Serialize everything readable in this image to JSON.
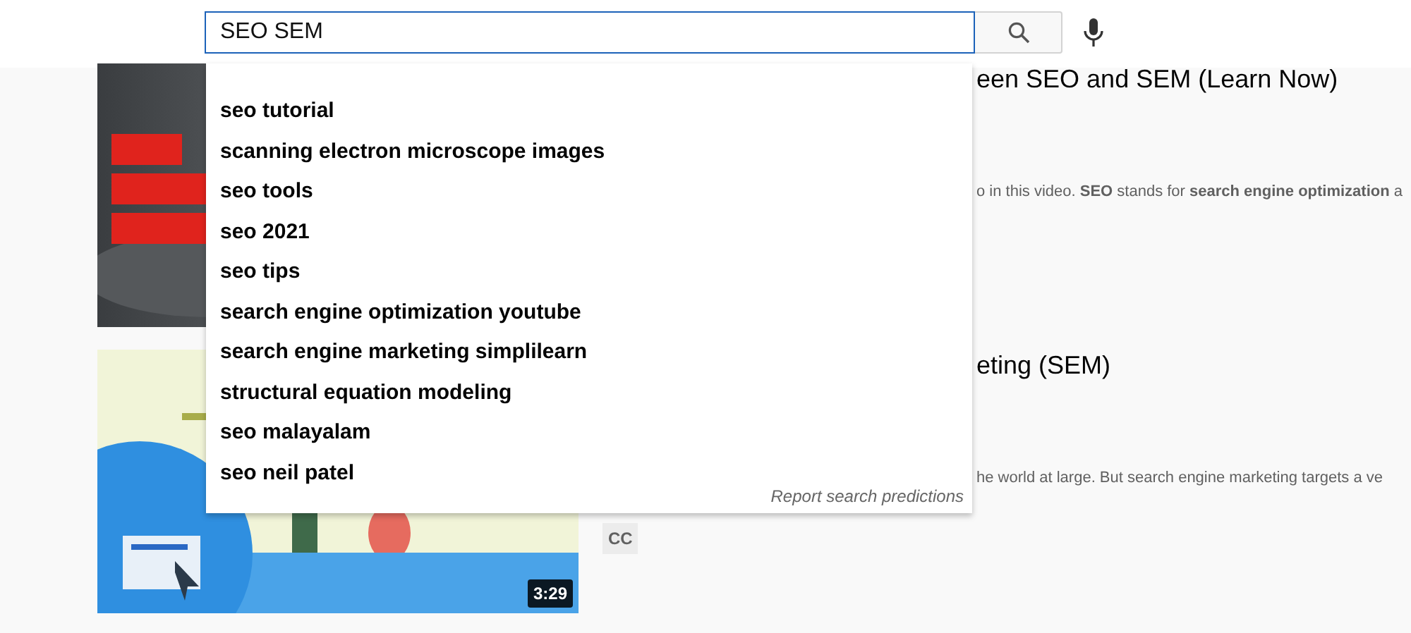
{
  "search": {
    "value": "SEO SEM"
  },
  "suggestions": [
    {
      "text": "seo tutorial"
    },
    {
      "text": "scanning electron microscope images"
    },
    {
      "text": "seo tools"
    },
    {
      "text": "seo 2021"
    },
    {
      "text": "seo tips"
    },
    {
      "text": "search engine optimization youtube"
    },
    {
      "text": "search engine marketing simplilearn"
    },
    {
      "text": "structural equation modeling"
    },
    {
      "text": "seo malayalam"
    },
    {
      "text": "seo neil patel"
    }
  ],
  "report_link": "Report search predictions",
  "results": [
    {
      "title": "een SEO and SEM (Learn Now)",
      "description": "o in this video. **SEO** stands for **search engine optimization** a"
    },
    {
      "title": "eting (SEM)",
      "description": "he world at large. But search engine marketing targets a ve",
      "badge": "CC",
      "duration": "3:29"
    }
  ]
}
